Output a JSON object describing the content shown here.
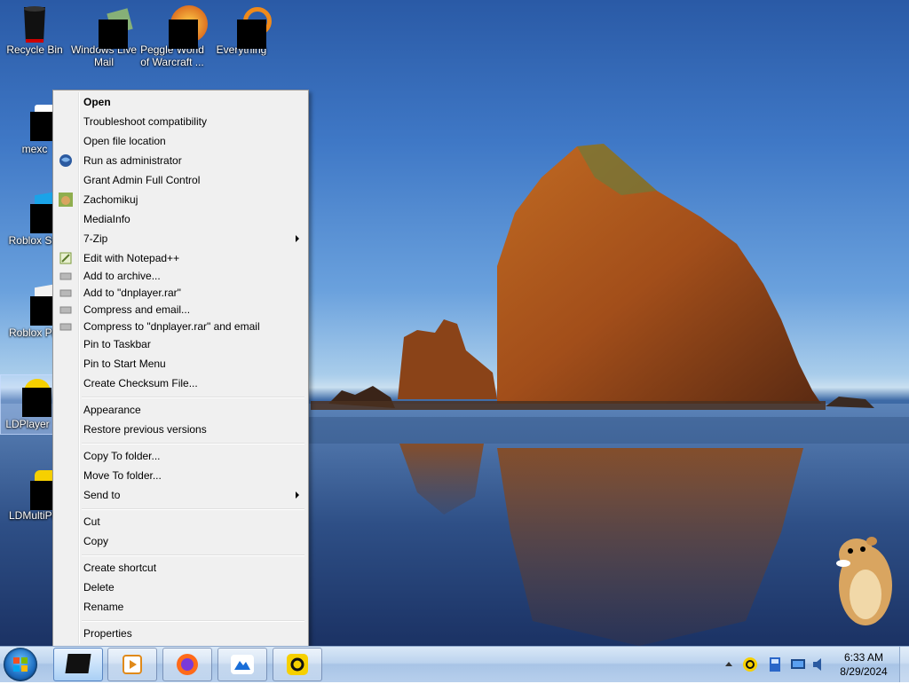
{
  "desktop_icons": [
    {
      "label": "Recycle Bin"
    },
    {
      "label_lines": [
        "Windows Live",
        "Mail"
      ]
    },
    {
      "label_lines": [
        "Peggle World",
        "of Warcraft ..."
      ]
    },
    {
      "label": "Everything"
    },
    {
      "label": "mexc"
    },
    {
      "label": "Roblox Stu"
    },
    {
      "label": "Roblox Pla"
    },
    {
      "label": "LDPlayer"
    },
    {
      "label": "LDMultiPla"
    }
  ],
  "context_menu": {
    "items": [
      {
        "label": "Open",
        "bold": true
      },
      {
        "label": "Troubleshoot compatibility"
      },
      {
        "label": "Open file location"
      },
      {
        "label": "Run as administrator",
        "icon": "shield-globe-icon"
      },
      {
        "label": "Grant Admin Full Control"
      },
      {
        "label": "Zachomikuj",
        "icon": "hamster-icon"
      },
      {
        "label": "MediaInfo"
      },
      {
        "label": "7-Zip",
        "submenu": true
      },
      {
        "label": "Edit with Notepad++",
        "icon": "notepad-icon"
      },
      {
        "label": "Add to archive...",
        "icon": "archive-icon"
      },
      {
        "label": "Add to \"dnplayer.rar\"",
        "icon": "archive-icon"
      },
      {
        "label": "Compress and email...",
        "icon": "archive-icon"
      },
      {
        "label": "Compress to \"dnplayer.rar\" and email",
        "icon": "archive-icon"
      },
      {
        "label": "Pin to Taskbar"
      },
      {
        "label": "Pin to Start Menu"
      },
      {
        "label": "Create Checksum File..."
      },
      {
        "label": "Appearance"
      },
      {
        "label": "Restore previous versions"
      },
      {
        "label": "Copy To folder..."
      },
      {
        "label": "Move To folder..."
      },
      {
        "label": "Send to",
        "submenu": true
      },
      {
        "label": "Cut"
      },
      {
        "label": "Copy"
      },
      {
        "label": "Create shortcut"
      },
      {
        "label": "Delete"
      },
      {
        "label": "Rename"
      },
      {
        "label": "Properties"
      }
    ]
  },
  "taskbar": {
    "pinned": [
      "ldplayer-app-icon",
      "media-player-icon",
      "firefox-icon",
      "cloud-app-icon",
      "ldmultiplayer-app-icon"
    ],
    "clock_time": "6:33 AM",
    "clock_date": "8/29/2024"
  },
  "colors": {
    "menu_bg": "#f0f0f0",
    "taskbar_top": "#d9e8f7",
    "sky": "#6aa1dd"
  }
}
